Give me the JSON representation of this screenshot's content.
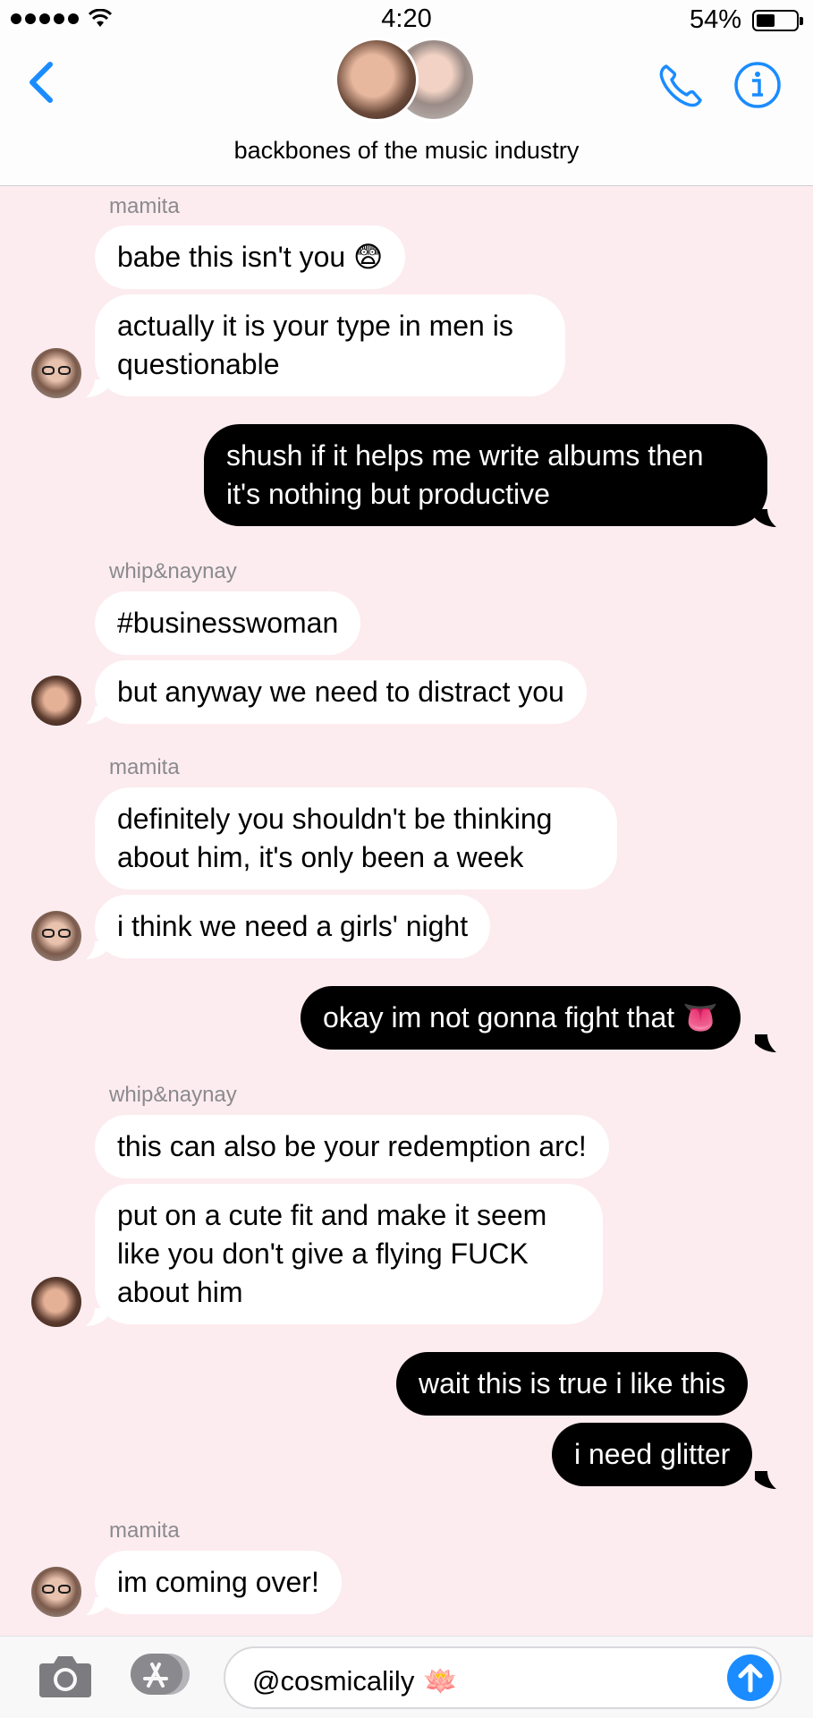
{
  "status_bar": {
    "time": "4:20",
    "battery_percent": "54%",
    "battery_level": 0.54
  },
  "header": {
    "group_name": "backbones of the music industry"
  },
  "messages": [
    {
      "sender": "mamita"
    },
    {
      "text": "babe this isn't you 😨"
    },
    {
      "text": "actually it is your type in men is questionable"
    },
    {
      "text": "shush if it helps me write albums then it's nothing but productive"
    },
    {
      "sender": "whip&naynay"
    },
    {
      "text": "#businesswoman"
    },
    {
      "text": "but anyway we need to distract you"
    },
    {
      "sender": "mamita"
    },
    {
      "text": "definitely you shouldn't be thinking about him, it's only been a week"
    },
    {
      "text": "i think we need a girls' night"
    },
    {
      "text": "okay im not gonna fight that 👅"
    },
    {
      "sender": "whip&naynay"
    },
    {
      "text": "this can also be your redemption arc!"
    },
    {
      "text": "put on a cute fit and make it seem like you don't give a flying FUCK about him"
    },
    {
      "text": "wait this is true i like this"
    },
    {
      "text": "i need glitter"
    },
    {
      "sender": "mamita"
    },
    {
      "text": "im coming over!"
    }
  ],
  "composer": {
    "value": "@cosmicalily",
    "emoji": "🪷"
  },
  "colors": {
    "accent": "#1a8cff",
    "background": "#fcecef",
    "incoming_bubble": "#ffffff",
    "outgoing_bubble": "#000000"
  },
  "icons": [
    "back-chevron-icon",
    "phone-icon",
    "info-icon",
    "camera-icon",
    "app-store-icon",
    "send-arrow-icon"
  ]
}
